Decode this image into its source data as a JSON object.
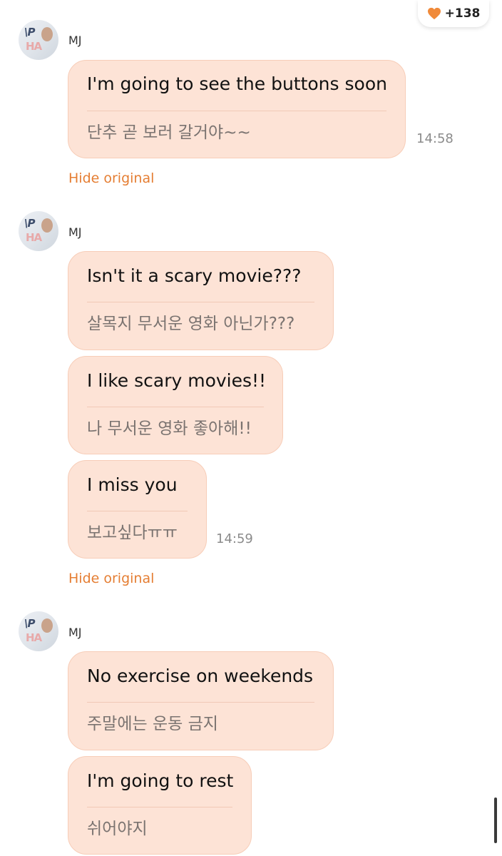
{
  "reaction": {
    "icon": "heart-icon",
    "count": "+138",
    "color": "#f08a3a"
  },
  "groups": [
    {
      "sender": "MJ",
      "messages": [
        {
          "text": "I'm going to see the buttons soon",
          "original": "단추 곧 보러 갈거야~~"
        }
      ],
      "time": "14:58",
      "hide_label": "Hide original"
    },
    {
      "sender": "MJ",
      "messages": [
        {
          "text": "Isn't it a scary movie???",
          "original": "살목지 무서운 영화 아닌가???"
        },
        {
          "text": "I like scary movies!!",
          "original": "나 무서운 영화 좋아해!!"
        },
        {
          "text": "I miss you",
          "original": "보고싶다ㅠㅠ"
        }
      ],
      "time": "14:59",
      "hide_label": "Hide original"
    },
    {
      "sender": "MJ",
      "messages": [
        {
          "text": "No exercise on weekends",
          "original": "주말에는 운동 금지"
        },
        {
          "text": "I'm going to rest",
          "original": "쉬어야지"
        }
      ]
    }
  ],
  "colors": {
    "bubble": "#fde3d6",
    "accent": "#e57e33"
  }
}
